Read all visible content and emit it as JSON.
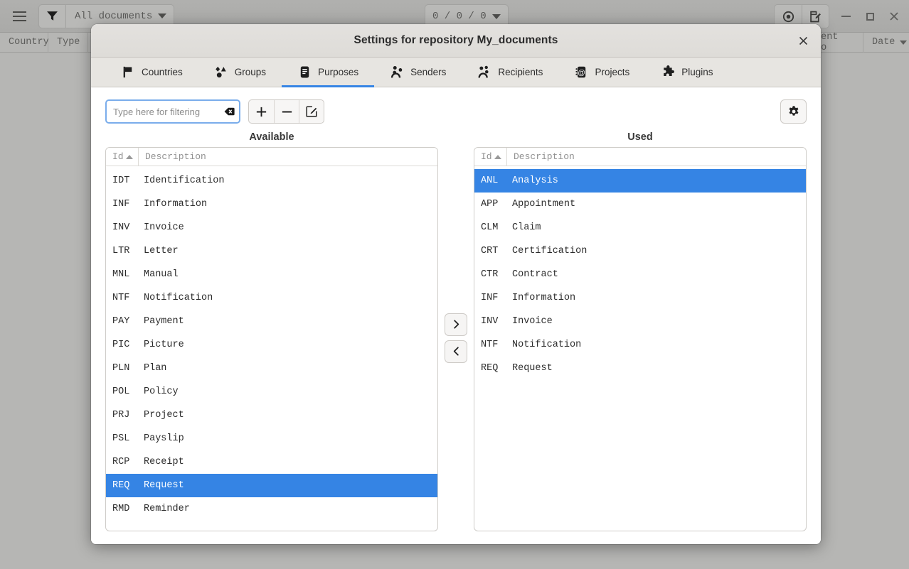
{
  "background_window": {
    "menu_icon": "hamburger-icon",
    "filter_icon": "funnel-icon",
    "filter_label": "All documents",
    "counter_label": "0 / 0 / 0",
    "tool_icons": [
      "eye-icon",
      "edit-document-icon"
    ],
    "window_controls": [
      "minimize",
      "maximize",
      "close"
    ],
    "columns": [
      "Country",
      "Type",
      "Sent to",
      "Date"
    ]
  },
  "dialog": {
    "title": "Settings for repository My_documents",
    "close_label": "✕",
    "tabs": [
      {
        "label": "Countries",
        "icon": "flag-icon",
        "active": false
      },
      {
        "label": "Groups",
        "icon": "shapes-icon",
        "active": false
      },
      {
        "label": "Purposes",
        "icon": "document-icon",
        "active": true
      },
      {
        "label": "Senders",
        "icon": "people-out-icon",
        "active": false
      },
      {
        "label": "Recipients",
        "icon": "people-in-icon",
        "active": false
      },
      {
        "label": "Projects",
        "icon": "at-card-icon",
        "active": false
      },
      {
        "label": "Plugins",
        "icon": "puzzle-icon",
        "active": false
      }
    ],
    "toolbar": {
      "filter_placeholder": "Type here for filtering",
      "filter_value": "",
      "clear_icon": "clear-icon",
      "add_label": "+",
      "remove_label": "−",
      "edit_icon": "edit-icon",
      "settings_icon": "gear-icon"
    },
    "transfer": {
      "add_icon": "chevron-right-icon",
      "remove_icon": "chevron-left-icon"
    },
    "available": {
      "title": "Available",
      "columns": [
        "Id",
        "Description"
      ],
      "sort_column": "Id",
      "sort_direction": "asc",
      "rows": [
        {
          "id": "IDT",
          "description": "Identification",
          "selected": false
        },
        {
          "id": "INF",
          "description": "Information",
          "selected": false
        },
        {
          "id": "INV",
          "description": "Invoice",
          "selected": false
        },
        {
          "id": "LTR",
          "description": "Letter",
          "selected": false
        },
        {
          "id": "MNL",
          "description": "Manual",
          "selected": false
        },
        {
          "id": "NTF",
          "description": "Notification",
          "selected": false
        },
        {
          "id": "PAY",
          "description": "Payment",
          "selected": false
        },
        {
          "id": "PIC",
          "description": "Picture",
          "selected": false
        },
        {
          "id": "PLN",
          "description": "Plan",
          "selected": false
        },
        {
          "id": "POL",
          "description": "Policy",
          "selected": false
        },
        {
          "id": "PRJ",
          "description": "Project",
          "selected": false
        },
        {
          "id": "PSL",
          "description": "Payslip",
          "selected": false
        },
        {
          "id": "RCP",
          "description": "Receipt",
          "selected": false
        },
        {
          "id": "REQ",
          "description": "Request",
          "selected": true
        },
        {
          "id": "RMD",
          "description": "Reminder",
          "selected": false
        }
      ]
    },
    "used": {
      "title": "Used",
      "columns": [
        "Id",
        "Description"
      ],
      "sort_column": "Id",
      "sort_direction": "asc",
      "rows": [
        {
          "id": "ANL",
          "description": "Analysis",
          "selected": true
        },
        {
          "id": "APP",
          "description": "Appointment",
          "selected": false
        },
        {
          "id": "CLM",
          "description": "Claim",
          "selected": false
        },
        {
          "id": "CRT",
          "description": "Certification",
          "selected": false
        },
        {
          "id": "CTR",
          "description": "Contract",
          "selected": false
        },
        {
          "id": "INF",
          "description": "Information",
          "selected": false
        },
        {
          "id": "INV",
          "description": "Invoice",
          "selected": false
        },
        {
          "id": "NTF",
          "description": "Notification",
          "selected": false
        },
        {
          "id": "REQ",
          "description": "Request",
          "selected": false
        }
      ]
    }
  },
  "colors": {
    "selection": "#3584e4",
    "dialog_header": "#e3e1de",
    "tabbar": "#e7e5e1",
    "desktop": "#b6b6b4"
  }
}
